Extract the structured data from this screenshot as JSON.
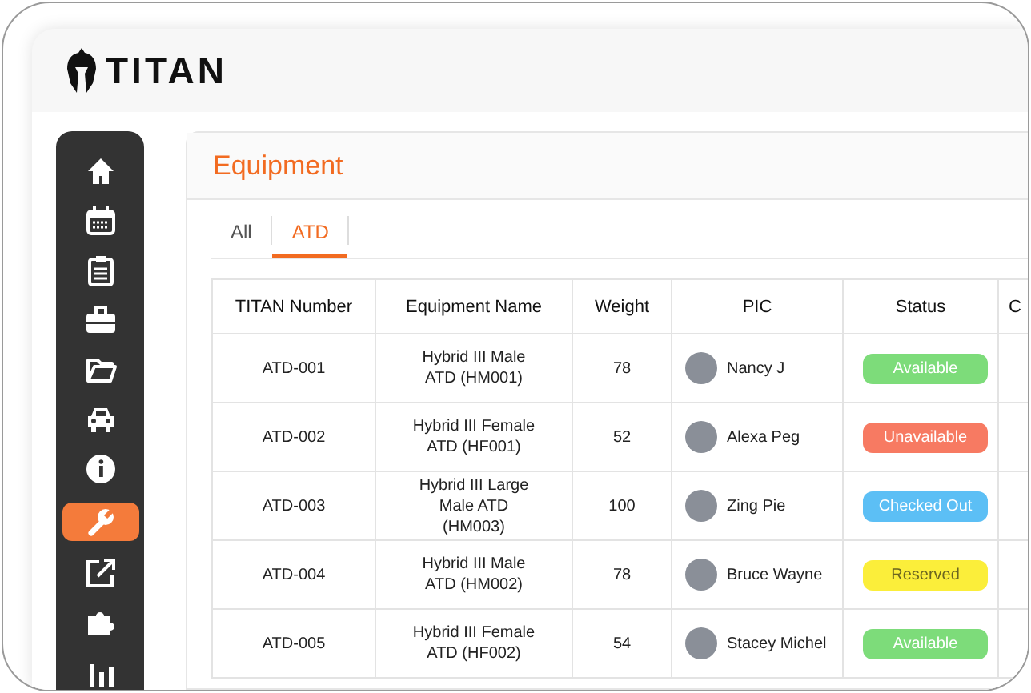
{
  "app": {
    "logo": "TITAN"
  },
  "sidebar": {
    "items": [
      {
        "selected": false
      },
      {
        "selected": false
      },
      {
        "selected": false
      },
      {
        "selected": false
      },
      {
        "selected": false
      },
      {
        "selected": false
      },
      {
        "selected": false
      },
      {
        "selected": true
      },
      {
        "selected": false
      },
      {
        "selected": false
      },
      {
        "selected": false
      }
    ]
  },
  "page": {
    "title": "Equipment"
  },
  "tabs": [
    {
      "label": "All",
      "selected": false
    },
    {
      "label": "ATD",
      "selected": true
    }
  ],
  "table": {
    "columns": [
      "TITAN Number",
      "Equipment Name",
      "Weight",
      "PIC",
      "Status",
      "C"
    ],
    "rows": [
      {
        "number": "ATD-001",
        "name": "Hybrid III Male ATD (HM001)",
        "weight": "78",
        "pic": "Nancy J",
        "status": {
          "label": "Available",
          "color": "#7ddc7a"
        }
      },
      {
        "number": "ATD-002",
        "name": "Hybrid III Female ATD (HF001)",
        "weight": "52",
        "pic": "Alexa Peg",
        "status": {
          "label": "Unavailable",
          "color": "#f77a62"
        }
      },
      {
        "number": "ATD-003",
        "name": "Hybrid III Large Male ATD (HM003)",
        "weight": "100",
        "pic": "Zing Pie",
        "status": {
          "label": "Checked Out",
          "color": "#5cbff5"
        }
      },
      {
        "number": "ATD-004",
        "name": "Hybrid III Male ATD (HM002)",
        "weight": "78",
        "pic": "Bruce Wayne",
        "status": {
          "label": "Reserved",
          "color": "#fbee3a"
        }
      },
      {
        "number": "ATD-005",
        "name": "Hybrid III Female ATD (HF002)",
        "weight": "54",
        "pic": "Stacey Michel",
        "status": {
          "label": "Available",
          "color": "#7ddc7a"
        }
      }
    ]
  }
}
